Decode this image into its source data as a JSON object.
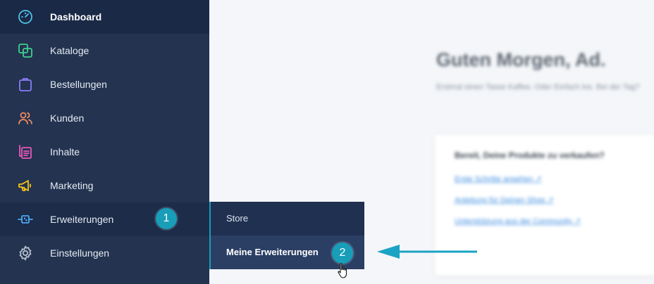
{
  "sidebar": {
    "items": [
      {
        "label": "Dashboard",
        "icon": "dashboard-gauge-icon",
        "color": "#4fc3e8"
      },
      {
        "label": "Kataloge",
        "icon": "catalog-copy-icon",
        "color": "#3fcf8e"
      },
      {
        "label": "Bestellungen",
        "icon": "shopping-bag-icon",
        "color": "#8b7cf6"
      },
      {
        "label": "Kunden",
        "icon": "users-icon",
        "color": "#f08a62"
      },
      {
        "label": "Inhalte",
        "icon": "content-list-icon",
        "color": "#e858b8"
      },
      {
        "label": "Marketing",
        "icon": "megaphone-icon",
        "color": "#f5c518"
      },
      {
        "label": "Erweiterungen",
        "icon": "plug-icon",
        "color": "#4fa8f0"
      },
      {
        "label": "Einstellungen",
        "icon": "gear-icon",
        "color": "#b6bfcc"
      }
    ],
    "active_item": "Dashboard",
    "open_item": "Erweiterungen"
  },
  "flyout": {
    "items": [
      {
        "label": "Store"
      },
      {
        "label": "Meine Erweiterungen"
      }
    ],
    "selected_item": "Meine Erweiterungen"
  },
  "badges": {
    "step1": "1",
    "step2": "2"
  },
  "colors": {
    "sidebar_bg": "#233350",
    "accent": "#189eb8",
    "arrow": "#1aa3c4"
  },
  "content": {
    "greeting": "Guten Morgen, Ad.",
    "subtitle": "Erstmal einen Tasse Kaffee. Oder Einfach los. Bei der Tag?",
    "card": {
      "title": "Bereit, Deine Produkte zu verkaufen?",
      "links": [
        "Erste Schritte ansehen ↗",
        "Anleitung für Deinen Shop ↗",
        "Unterstützung aus der Community ↗"
      ]
    }
  }
}
